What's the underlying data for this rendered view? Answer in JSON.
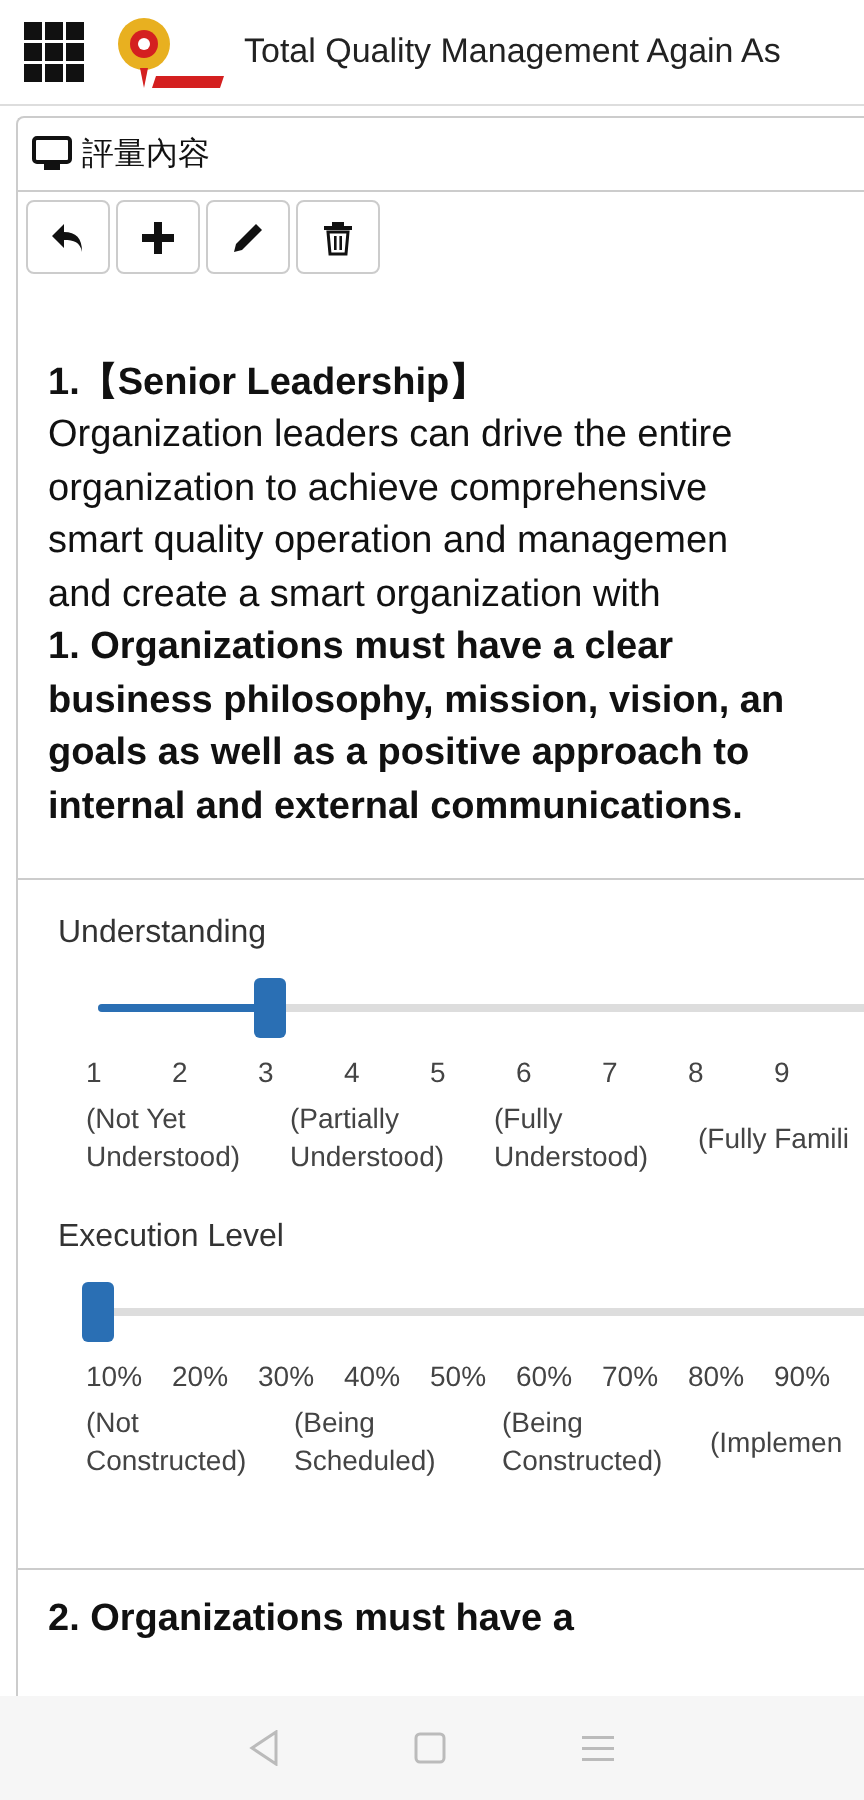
{
  "app_bar": {
    "title": "Total Quality Management Again As"
  },
  "panel": {
    "title": "評量內容"
  },
  "toolbar": [
    {
      "kind": "back"
    },
    {
      "kind": "add"
    },
    {
      "kind": "edit"
    },
    {
      "kind": "delete"
    }
  ],
  "question": {
    "heading": "1.【Senior Leadership】",
    "lines": [
      "Organization leaders can drive the entire",
      "organization to achieve comprehensive",
      "smart quality operation and managemen",
      "and create a smart organization with"
    ],
    "bold_lines": [
      "1. Organizations must have a clear",
      "business philosophy, mission, vision, an",
      "goals as well as a positive approach to",
      "internal and external communications."
    ]
  },
  "sliders": [
    {
      "label": "Understanding",
      "level": 0.222,
      "ticks": [
        "1",
        "2",
        "3",
        "4",
        "5",
        "6",
        "7",
        "8",
        "9"
      ],
      "captions": [
        "(Not Yet\nUnderstood)",
        "(Partially\nUnderstood)",
        "(Fully\nUnderstood)",
        "(Fully Famili"
      ]
    },
    {
      "label": "Execution Level",
      "level": 0,
      "ticks": [
        "10%",
        "20%",
        "30%",
        "40%",
        "50%",
        "60%",
        "70%",
        "80%",
        "90%"
      ],
      "captions": [
        "(Not\nConstructed)",
        "(Being\nScheduled)",
        "(Being\nConstructed)",
        "(Implemen"
      ]
    }
  ],
  "next_question": "2. Organizations must have a"
}
